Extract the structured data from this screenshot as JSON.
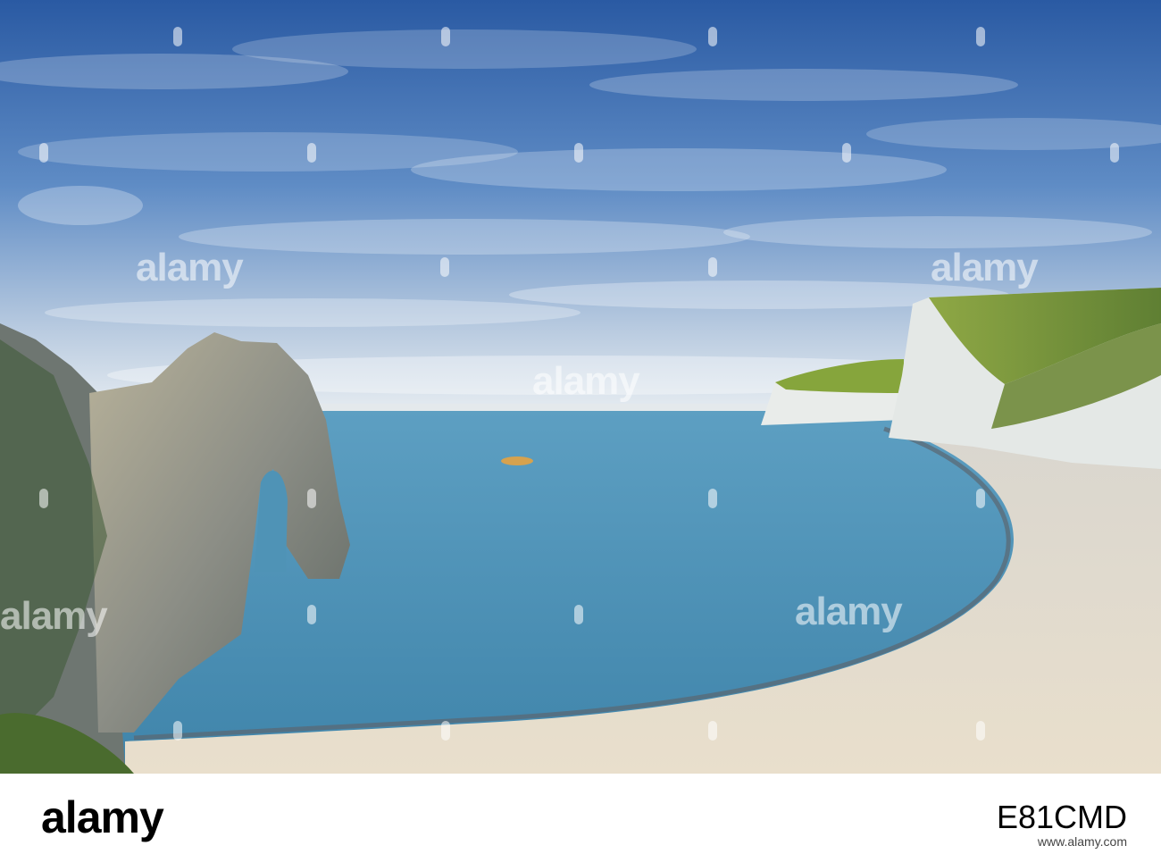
{
  "watermark": {
    "text": "alamy"
  },
  "footer": {
    "brand": "alamy",
    "image_id": "E81CMD",
    "url": "www.alamy.com"
  },
  "colors": {
    "sky_top": "#2f5fa6",
    "sky_horizon": "#dfe6ee",
    "sea": "#4f93b6",
    "beach": "#e3dccf",
    "cliff_chalk": "#e8ebe9",
    "grass": "#7b9a3c"
  }
}
